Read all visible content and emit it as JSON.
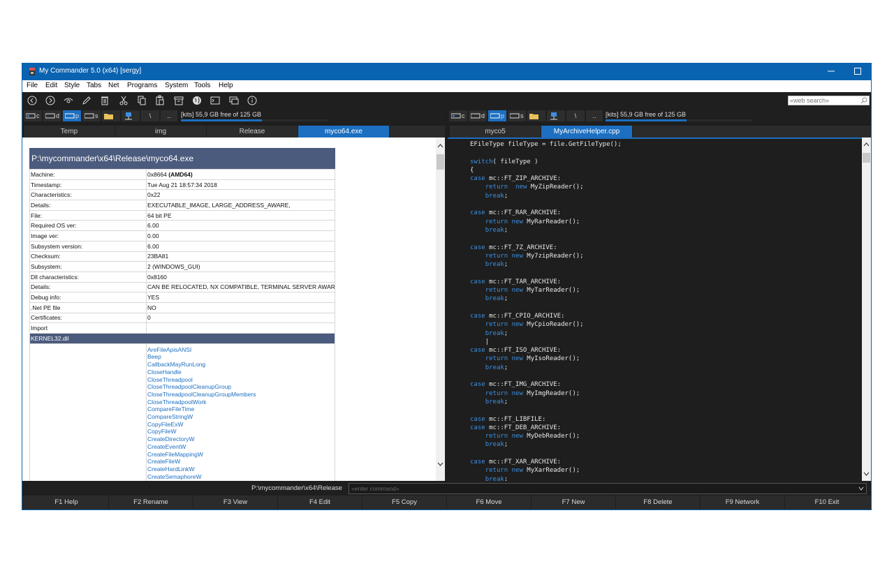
{
  "window": {
    "title": "My Commander 5.0 (x64) [sergy]"
  },
  "menu": [
    "File",
    "Edit",
    "Style",
    "Tabs",
    "Net",
    "Programs",
    "System",
    "Tools",
    "Help"
  ],
  "toolbar": {
    "icons": [
      "back-icon",
      "forward-icon",
      "eye-icon",
      "pencil-icon",
      "trash-icon",
      "scissors-icon",
      "copy-icon",
      "paste-icon",
      "archive-icon",
      "globe-icon",
      "terminal-icon",
      "chat-icon",
      "info-icon"
    ],
    "web_search_placeholder": "«web search»"
  },
  "left": {
    "drives": [
      {
        "letter": "c",
        "selected": false
      },
      {
        "letter": "d",
        "selected": false
      },
      {
        "letter": "p",
        "selected": true
      },
      {
        "letter": "s",
        "selected": false
      }
    ],
    "root_label": "\\",
    "up_label": "..",
    "free_space": "[kits] 55,9 GB free of 125 GB",
    "free_fraction": 0.55,
    "tabs": [
      {
        "label": "Temp",
        "active": false
      },
      {
        "label": "img",
        "active": false
      },
      {
        "label": "Release",
        "active": false
      },
      {
        "label": "myco64.exe",
        "active": true
      }
    ],
    "info_title": "P:\\mycommander\\x64\\Release\\myco64.exe",
    "rows": [
      {
        "k": "Machine:",
        "v": "0x8664 ",
        "vb": "(AMD64)"
      },
      {
        "k": "Timestamp:",
        "v": "Tue Aug 21 18:57:34 2018"
      },
      {
        "k": "Characteristics:",
        "v": "0x22"
      },
      {
        "k": "Details:",
        "v": "EXECUTABLE_IMAGE, LARGE_ADDRESS_AWARE,"
      },
      {
        "k": "File:",
        "v": "64 bit PE"
      },
      {
        "k": "Required OS ver:",
        "v": "6.00"
      },
      {
        "k": "Image ver:",
        "v": "0.00"
      },
      {
        "k": "Subsystem version:",
        "v": "6.00"
      },
      {
        "k": "Checksum:",
        "v": "23BA81"
      },
      {
        "k": "Subsystem:",
        "v": "2 (WINDOWS_GUI)"
      },
      {
        "k": "Dll characteristics:",
        "v": "0x8160"
      },
      {
        "k": "Details:",
        "v": "CAN BE RELOCATED, NX COMPATIBLE, TERMINAL SERVER AWARE,"
      },
      {
        "k": "Debug info:",
        "v": "YES"
      },
      {
        "k": ".Net PE file",
        "v": "NO"
      },
      {
        "k": "Certificates:",
        "v": "0"
      },
      {
        "k": "Import",
        "v": ""
      }
    ],
    "import_dll": "KERNEL32.dll",
    "functions": [
      "AreFileApisANSI",
      "Beep",
      "CallbackMayRunLong",
      "CloseHandle",
      "CloseThreadpool",
      "CloseThreadpoolCleanupGroup",
      "CloseThreadpoolCleanupGroupMembers",
      "CloseThreadpoolWork",
      "CompareFileTime",
      "CompareStringW",
      "CopyFileExW",
      "CopyFileW",
      "CreateDirectoryW",
      "CreateEventW",
      "CreateFileMappingW",
      "CreateFileW",
      "CreateHardLinkW",
      "CreateSemaphoreW"
    ]
  },
  "right": {
    "drives": [
      {
        "letter": "c",
        "selected": false
      },
      {
        "letter": "d",
        "selected": false
      },
      {
        "letter": "p",
        "selected": true
      },
      {
        "letter": "s",
        "selected": false
      }
    ],
    "root_label": "\\",
    "up_label": "..",
    "free_space": "[kits] 55,9 GB free of 125 GB",
    "free_fraction": 0.55,
    "tabs": [
      {
        "label": "myco5",
        "active": false
      },
      {
        "label": "MyArchiveHelper.cpp",
        "active": true
      }
    ],
    "code": [
      "EFileType fileType = file.GetFileType();",
      "",
      "switch( fileType )",
      "{",
      "case mc::FT_ZIP_ARCHIVE:",
      "    return  new MyZipReader();",
      "    break;",
      "",
      "case mc::FT_RAR_ARCHIVE:",
      "    return new MyRarReader();",
      "    break;",
      "",
      "case mc::FT_7Z_ARCHIVE:",
      "    return new My7zipReader();",
      "    break;",
      "",
      "case mc::FT_TAR_ARCHIVE:",
      "    return new MyTarReader();",
      "    break;",
      "",
      "case mc::FT_CPIO_ARCHIVE:",
      "    return new MyCpioReader();",
      "    break;",
      "    |",
      "case mc::FT_ISO_ARCHIVE:",
      "    return new MyIsoReader();",
      "    break;",
      "",
      "case mc::FT_IMG_ARCHIVE:",
      "    return new MyImgReader();",
      "    break;",
      "",
      "case mc::FT_LIBFILE:",
      "case mc::FT_DEB_ARCHIVE:",
      "    return new MyDebReader();",
      "    break;",
      "",
      "case mc::FT_XAR_ARCHIVE:",
      "    return new MyXarReader();",
      "    break;"
    ]
  },
  "cmdline": {
    "path": "P:\\mycommander\\x64\\Release",
    "placeholder": "«enter command»"
  },
  "fkeys": [
    "F1 Help",
    "F2 Rename",
    "F3 View",
    "F4 Edit",
    "F5 Copy",
    "F6 Move",
    "F7 New",
    "F8 Delete",
    "F9 Network",
    "F10 Exit"
  ],
  "colors": {
    "accent": "#1c6fc1",
    "titlebar": "#0a63b0",
    "info_header": "#4b5b7d",
    "keyword": "#3d8fe0"
  }
}
